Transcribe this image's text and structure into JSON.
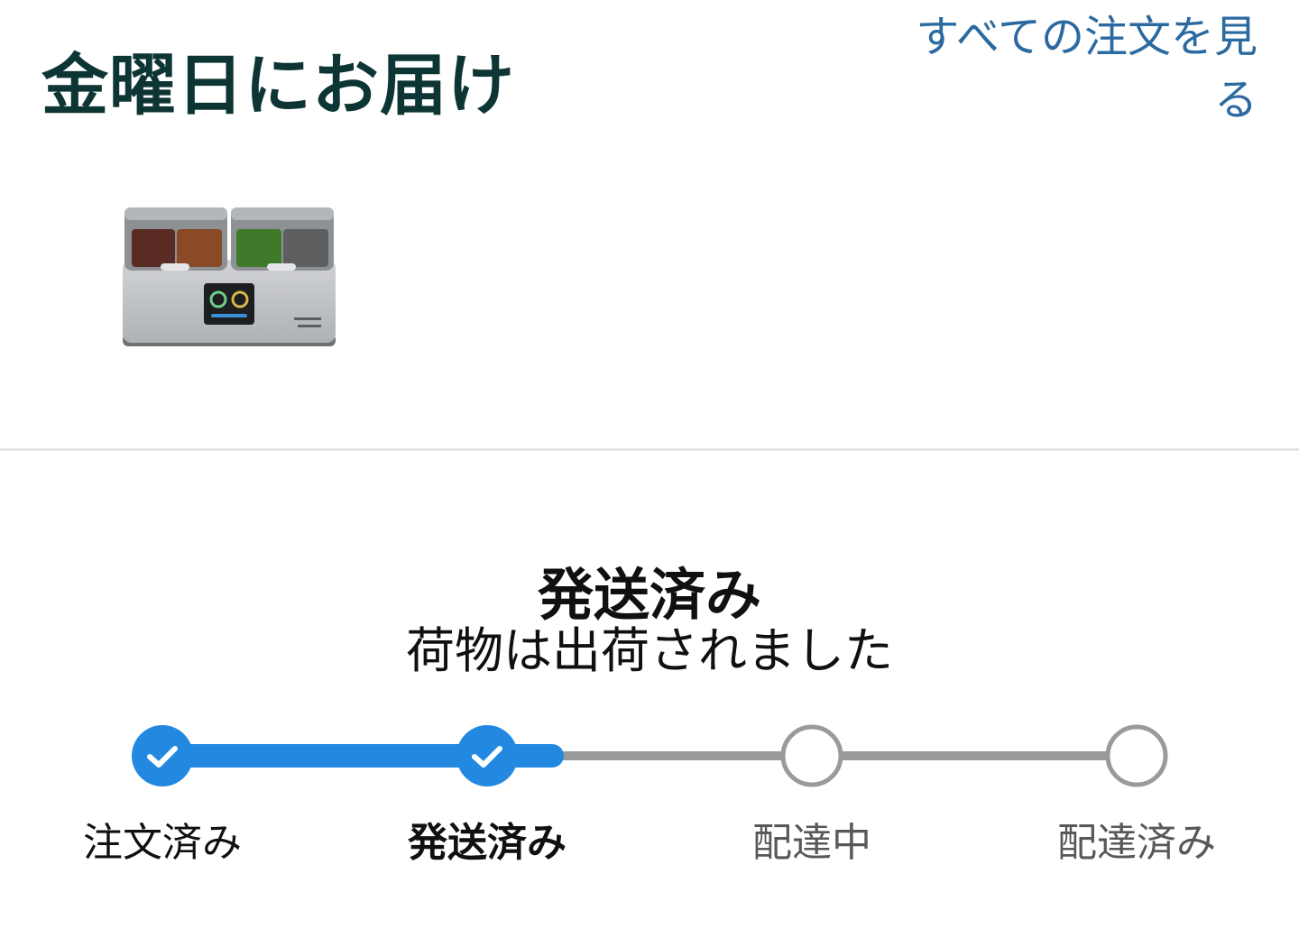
{
  "header": {
    "title": "金曜日にお届け",
    "view_all_orders_link": "すべての注文を見る"
  },
  "product": {
    "image_icon": "3d-printer-filament-dryer-box-image",
    "image_alt": "CREALITY Space Pi"
  },
  "status": {
    "heading": "発送済み",
    "message": "荷物は出荷されました"
  },
  "tracker": {
    "progress_fraction": 0.4,
    "steps": [
      {
        "label": "注文済み",
        "state": "complete"
      },
      {
        "label": "発送済み",
        "state": "current"
      },
      {
        "label": "配達中",
        "state": "pending"
      },
      {
        "label": "配達済み",
        "state": "pending"
      }
    ]
  },
  "colors": {
    "title": "#0d3534",
    "link": "#2b6aa0",
    "progress_active": "#2389e0",
    "progress_inactive": "#9a9a9a"
  }
}
